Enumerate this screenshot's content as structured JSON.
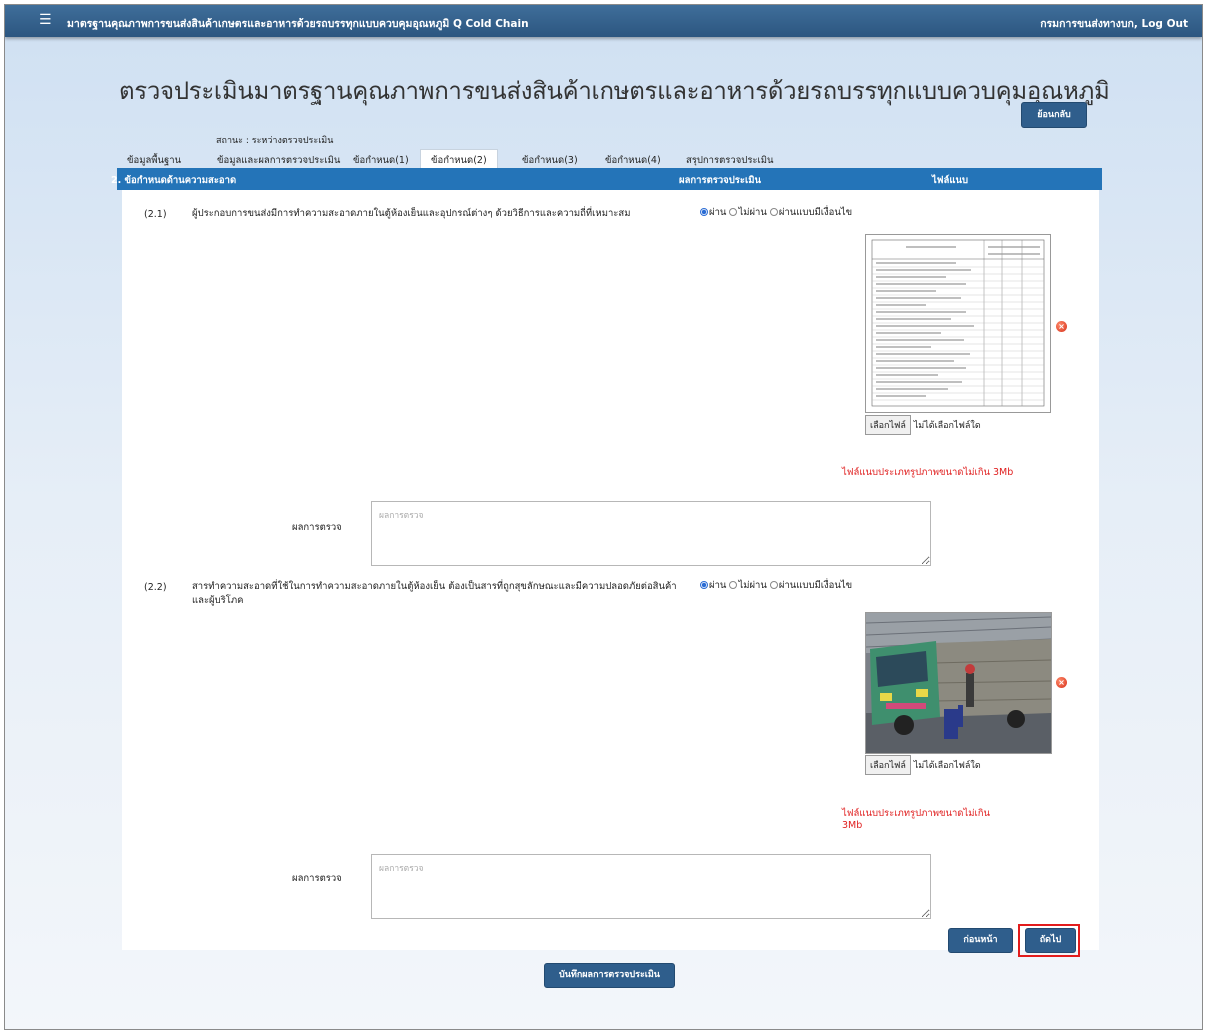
{
  "header": {
    "menu_glyph": "☰",
    "app_title": "มาตรฐานคุณภาพการขนส่งสินค้าเกษตรและอาหารด้วยรถบรรทุกแบบควบคุมอุณหภูมิ Q Cold Chain",
    "user_text": "กรมการขนส่งทางบก, Log Out"
  },
  "page": {
    "title": "ตรวจประเมินมาตรฐานคุณภาพการขนส่งสินค้าเกษตรและอาหารด้วยรถบรรทุกแบบควบคุมอุณหภูมิ",
    "back_label": "ย้อนกลับ",
    "status": "สถานะ : ระหว่างตรวจประเมิน"
  },
  "tabs": [
    {
      "label": "ข้อมูลพื้นฐาน",
      "active": false
    },
    {
      "label": "ข้อมูลและผลการตรวจประเมิน",
      "active": false
    },
    {
      "label": "ข้อกำหนด(1)",
      "active": false
    },
    {
      "label": "ข้อกำหนด(2)",
      "active": true
    },
    {
      "label": "ข้อกำหนด(3)",
      "active": false
    },
    {
      "label": "ข้อกำหนด(4)",
      "active": false
    },
    {
      "label": "สรุปการตรวจประเมิน",
      "active": false
    }
  ],
  "section": {
    "title": "2. ข้อกำหนดด้านความสะอาด",
    "col_result": "ผลการตรวจประเมิน",
    "col_file": "ไฟล์แนบ"
  },
  "radio_labels": {
    "pass": "ผ่าน",
    "fail": "ไม่ผ่าน",
    "conditional": "ผ่านแบบมีเงื่อนไข"
  },
  "items": [
    {
      "number": "(2.1)",
      "text": "ผู้ประกอบการขนส่งมีการทำความสะอาดภายในตู้ห้องเย็นและอุปกรณ์ต่างๆ ด้วยวิธีการและความถี่ที่เหมาะสม",
      "selected": "pass",
      "attachment": "document",
      "choose_file": "เลือกไฟล์",
      "no_file": "ไม่ได้เลือกไฟล์ใด",
      "file_note": "ไฟล์แนบประเภทรูปภาพขนาดไม่เกิน 3Mb",
      "result_label": "ผลการตรวจ",
      "result_placeholder": "ผลการตรวจ",
      "result_value": ""
    },
    {
      "number": "(2.2)",
      "text": "สารทำความสะอาดที่ใช้ในการทำความสะอาดภายในตู้ห้องเย็น ต้องเป็นสารที่ถูกสุขลักษณะและมีความปลอดภัยต่อสินค้าและผู้บริโภค",
      "selected": "pass",
      "attachment": "photo",
      "choose_file": "เลือกไฟล์",
      "no_file": "ไม่ได้เลือกไฟล์ใด",
      "file_note": "ไฟล์แนบประเภทรูปภาพขนาดไม่เกิน 3Mb",
      "result_label": "ผลการตรวจ",
      "result_placeholder": "ผลการตรวจ",
      "result_value": ""
    }
  ],
  "nav": {
    "prev_label": "ก่อนหน้า",
    "next_label": "ถัดไป"
  },
  "save_label": "บันทึกผลการตรวจประเมิน",
  "colors": {
    "header_bar": "#2c5680",
    "section_bar": "#2474b8",
    "button": "#2f5e8c",
    "note_red": "#e02020",
    "highlight": "#e21c1c"
  }
}
